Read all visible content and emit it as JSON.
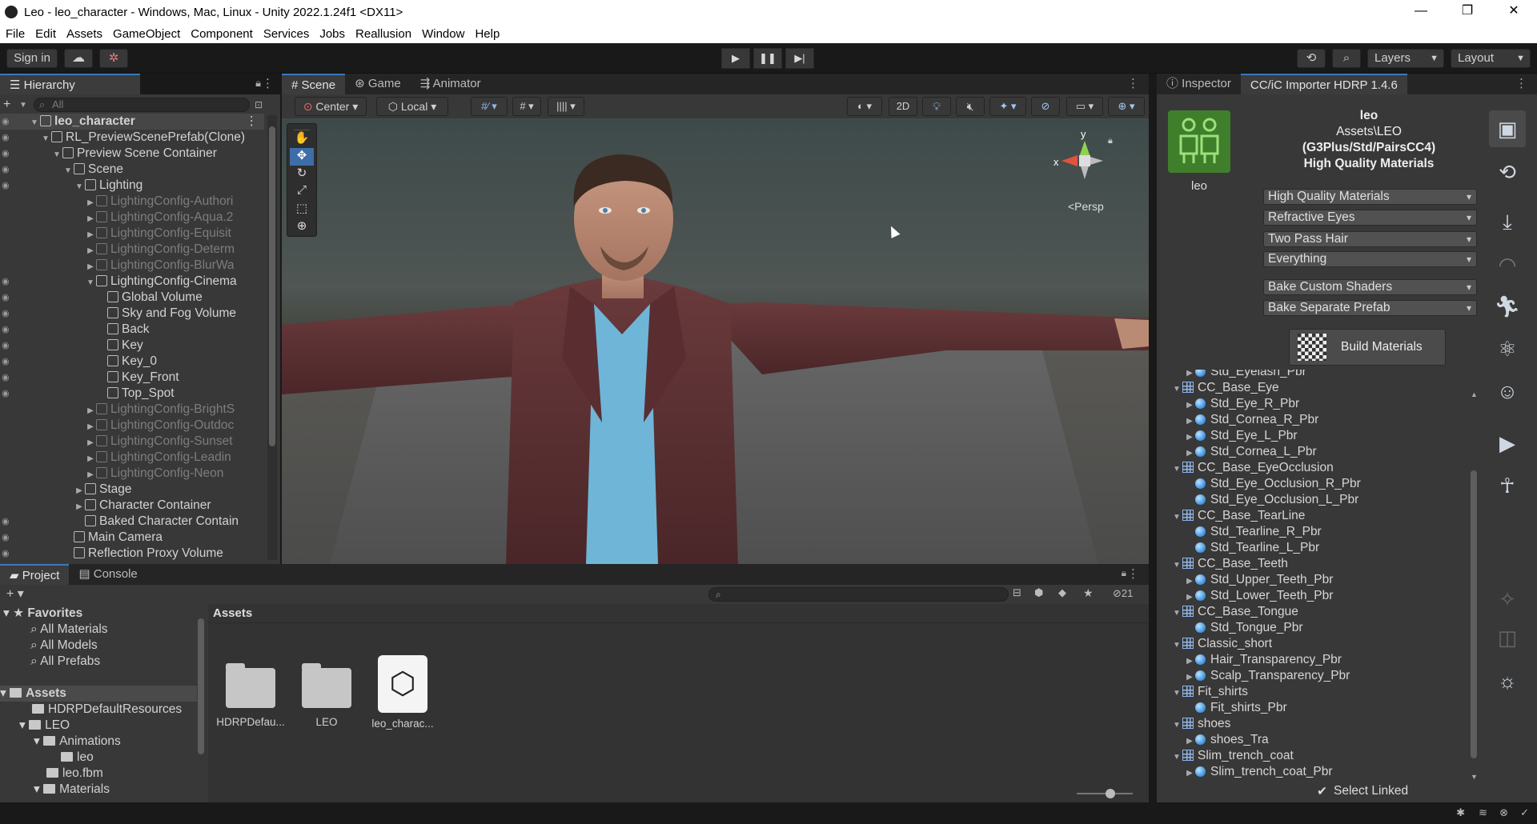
{
  "window": {
    "title": "Leo - leo_character - Windows, Mac, Linux - Unity 2022.1.24f1 <DX11>",
    "controls": [
      "—",
      "❐",
      "✕"
    ]
  },
  "menu": [
    "File",
    "Edit",
    "Assets",
    "GameObject",
    "Component",
    "Services",
    "Jobs",
    "Reallusion",
    "Window",
    "Help"
  ],
  "toolbar": {
    "sign_in": "Sign in",
    "layers": "Layers",
    "layout": "Layout"
  },
  "hierarchy": {
    "tab": "Hierarchy",
    "search_placeholder": "All",
    "rows": [
      {
        "label": "leo_character",
        "depth": 0,
        "dim": false,
        "bold": true
      },
      {
        "label": "RL_PreviewScenePrefab(Clone)",
        "depth": 1,
        "dim": false
      },
      {
        "label": "Preview Scene Container",
        "depth": 2,
        "dim": false
      },
      {
        "label": "Scene",
        "depth": 3,
        "dim": false
      },
      {
        "label": "Lighting",
        "depth": 4,
        "dim": false
      },
      {
        "label": "LightingConfig-Authori",
        "depth": 5,
        "dim": true
      },
      {
        "label": "LightingConfig-Aqua.2",
        "depth": 5,
        "dim": true
      },
      {
        "label": "LightingConfig-Equisit",
        "depth": 5,
        "dim": true
      },
      {
        "label": "LightingConfig-Determ",
        "depth": 5,
        "dim": true
      },
      {
        "label": "LightingConfig-BlurWa",
        "depth": 5,
        "dim": true
      },
      {
        "label": "LightingConfig-Cinema",
        "depth": 5,
        "dim": false
      },
      {
        "label": "Global Volume",
        "depth": 6,
        "dim": false
      },
      {
        "label": "Sky and Fog Volume",
        "depth": 6,
        "dim": false
      },
      {
        "label": "Back",
        "depth": 6,
        "dim": false
      },
      {
        "label": "Key",
        "depth": 6,
        "dim": false
      },
      {
        "label": "Key_0",
        "depth": 6,
        "dim": false
      },
      {
        "label": "Key_Front",
        "depth": 6,
        "dim": false
      },
      {
        "label": "Top_Spot",
        "depth": 6,
        "dim": false
      },
      {
        "label": "LightingConfig-BrightS",
        "depth": 5,
        "dim": true
      },
      {
        "label": "LightingConfig-Outdoc",
        "depth": 5,
        "dim": true
      },
      {
        "label": "LightingConfig-Sunset",
        "depth": 5,
        "dim": true
      },
      {
        "label": "LightingConfig-Leadin",
        "depth": 5,
        "dim": true
      },
      {
        "label": "LightingConfig-Neon",
        "depth": 5,
        "dim": true
      },
      {
        "label": "Stage",
        "depth": 4,
        "dim": false
      },
      {
        "label": "Character Container",
        "depth": 4,
        "dim": false
      },
      {
        "label": "Baked Character Contain",
        "depth": 4,
        "dim": false
      },
      {
        "label": "Main Camera",
        "depth": 3,
        "dim": false
      },
      {
        "label": "Reflection Proxy Volume",
        "depth": 3,
        "dim": false
      }
    ]
  },
  "scene": {
    "tabs": [
      "Scene",
      "Game",
      "Animator"
    ],
    "pivot": "Center",
    "space": "Local",
    "mode_2d": "2D",
    "persp": "<Persp",
    "gizmo": {
      "y": "y",
      "x": "x"
    }
  },
  "inspector": {
    "tabs": [
      "Inspector",
      "CC/iC Importer HDRP 1.4.6"
    ],
    "character_name": "leo",
    "header": [
      "leo",
      "Assets\\LEO",
      "(G3Plus/Std/PairsCC4)",
      "High Quality Materials"
    ],
    "dropdowns": [
      "High Quality Materials",
      "Refractive Eyes",
      "Two Pass Hair",
      "Everything",
      "Bake Custom Shaders",
      "Bake Separate Prefab"
    ],
    "build_button": "Build Materials",
    "tree": [
      {
        "label": "Std_Eyelash_Pbr",
        "type": "mat"
      },
      {
        "label": "CC_Base_Eye",
        "type": "mesh"
      },
      {
        "label": "Std_Eye_R_Pbr",
        "type": "mat"
      },
      {
        "label": "Std_Cornea_R_Pbr",
        "type": "mat"
      },
      {
        "label": "Std_Eye_L_Pbr",
        "type": "mat"
      },
      {
        "label": "Std_Cornea_L_Pbr",
        "type": "mat"
      },
      {
        "label": "CC_Base_EyeOcclusion",
        "type": "mesh"
      },
      {
        "label": "Std_Eye_Occlusion_R_Pbr",
        "type": "mat"
      },
      {
        "label": "Std_Eye_Occlusion_L_Pbr",
        "type": "mat"
      },
      {
        "label": "CC_Base_TearLine",
        "type": "mesh"
      },
      {
        "label": "Std_Tearline_R_Pbr",
        "type": "mat"
      },
      {
        "label": "Std_Tearline_L_Pbr",
        "type": "mat"
      },
      {
        "label": "CC_Base_Teeth",
        "type": "mesh"
      },
      {
        "label": "Std_Upper_Teeth_Pbr",
        "type": "mat"
      },
      {
        "label": "Std_Lower_Teeth_Pbr",
        "type": "mat"
      },
      {
        "label": "CC_Base_Tongue",
        "type": "mesh"
      },
      {
        "label": "Std_Tongue_Pbr",
        "type": "mat"
      },
      {
        "label": "Classic_short",
        "type": "mesh"
      },
      {
        "label": "Hair_Transparency_Pbr",
        "type": "mat"
      },
      {
        "label": "Scalp_Transparency_Pbr",
        "type": "mat"
      },
      {
        "label": "Fit_shirts",
        "type": "mesh"
      },
      {
        "label": "Fit_shirts_Pbr",
        "type": "mat"
      },
      {
        "label": "shoes",
        "type": "mesh"
      },
      {
        "label": "shoes_Tra",
        "type": "mat"
      },
      {
        "label": "Slim_trench_coat",
        "type": "mesh"
      },
      {
        "label": "Slim_trench_coat_Pbr",
        "type": "mat"
      }
    ],
    "select_linked": "Select Linked"
  },
  "project": {
    "tabs": [
      "Project",
      "Console"
    ],
    "favorites_label": "Favorites",
    "favorites": [
      "All Materials",
      "All Models",
      "All Prefabs"
    ],
    "assets_label": "Assets",
    "tree": [
      {
        "label": "HDRPDefaultResources",
        "depth": 1
      },
      {
        "label": "LEO",
        "depth": 1
      },
      {
        "label": "Animations",
        "depth": 2
      },
      {
        "label": "leo",
        "depth": 3
      },
      {
        "label": "leo.fbm",
        "depth": 2
      },
      {
        "label": "Materials",
        "depth": 2
      }
    ],
    "breadcrumb": "Assets",
    "hidden_count": "21",
    "items": [
      "HDRPDefau...",
      "LEO",
      "leo_charac..."
    ]
  }
}
